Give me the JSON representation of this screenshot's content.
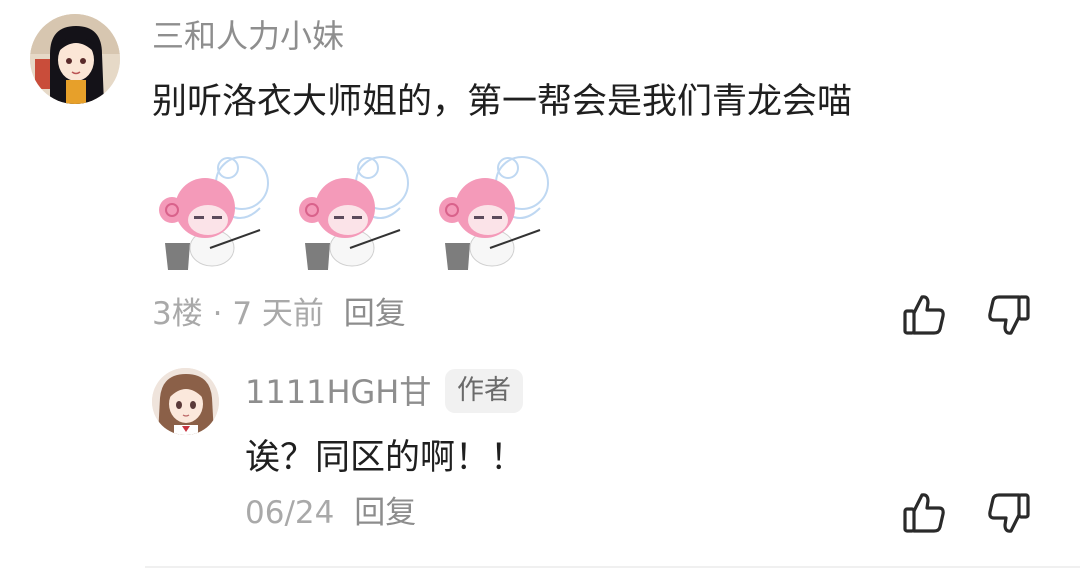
{
  "comment": {
    "username": "三和人力小妹",
    "text": "别听洛衣大师姐的，第一帮会是我们青龙会喵",
    "floor": "3楼",
    "separator": "·",
    "time": "7 天前",
    "reply_label": "回复",
    "sticker_count": 3,
    "avatar_icon": "anime-girl-avatar"
  },
  "reply": {
    "username": "1111HGH甘",
    "badge": "作者",
    "text": "诶？同区的啊！！",
    "time": "06/24",
    "reply_label": "回复",
    "avatar_icon": "anime-girl-avatar"
  },
  "icons": {
    "like": "thumbs-up-icon",
    "dislike": "thumbs-down-icon"
  },
  "colors": {
    "username": "#8e8e8e",
    "text": "#1f1f1f",
    "meta": "#a9a9a9",
    "sticker_pink": "#f49ab9",
    "badge_bg": "#f1f1f1"
  }
}
